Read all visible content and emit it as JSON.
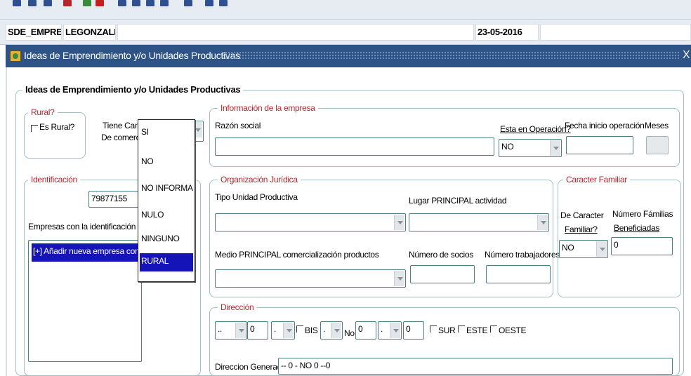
{
  "context": {
    "schema": "SDE_EMPRES/",
    "user": "LEGONZALEZ",
    "date": "23-05-2016"
  },
  "window": {
    "title": "Ideas de Emprendimiento y/o Unidades Productivas",
    "close": "X"
  },
  "main_group": {
    "legend": "Ideas de Emprendimiento y/o Unidades Productivas"
  },
  "rural": {
    "legend": "Rural?",
    "es_rural_label": "Es Rural?",
    "tiene_camara_label_1": "Tiene Cama",
    "tiene_camara_label_2": "De comercic"
  },
  "dropdown_options": [
    "SI",
    "NO",
    "NO INFORMA",
    "NULO",
    "NINGUNO",
    "RURAL"
  ],
  "identificacion": {
    "legend": "Identificación",
    "id_value": "79877155",
    "empresas_label": "Empresas con la identificación dad",
    "list_row": "[+] Añadir nueva empresa con es"
  },
  "info_empresa": {
    "legend": "Información de la empresa",
    "razon_social_label": "Razón social",
    "razon_social_value": "",
    "operacion_label": "Esta en Operación?",
    "operacion_value": "NO",
    "fecha_label": "Fecha inicio operación",
    "fecha_value": "",
    "meses_label": "Meses",
    "meses_value": ""
  },
  "organizacion": {
    "legend": "Organización Jurídica",
    "tipo_label": "Tipo Unidad Productiva",
    "tipo_value": "",
    "lugar_label": "Lugar PRINCIPAL actividad",
    "lugar_value": "",
    "medio_label": "Medio PRINCIPAL comercialización productos",
    "medio_value": "",
    "socios_label": "Número de socios",
    "socios_value": "",
    "trabajadores_label": "Número trabajadores",
    "trabajadores_value": ""
  },
  "familiar": {
    "legend": "Caracter Familiar",
    "caracter_label_1": "De Caracter",
    "caracter_label_2": "Familiar?",
    "caracter_value": "NO",
    "familias_label_1": "Número Fámilias",
    "familias_label_2": "Beneficiadas",
    "familias_value": "0"
  },
  "direccion": {
    "legend": "Dirección",
    "tipo_via": "..",
    "numero_1": "0",
    "letra_1": ".",
    "bis_label": "BIS",
    "letra_2": ".",
    "no_label": "No",
    "numero_2": "0",
    "letra_3": ".",
    "numero_3": "0",
    "sur_label": "SUR",
    "este_label": "ESTE",
    "oeste_label": "OESTE",
    "generada_label": "Direccion Generada",
    "generada_value": "-- 0 - NO  0 --0"
  }
}
